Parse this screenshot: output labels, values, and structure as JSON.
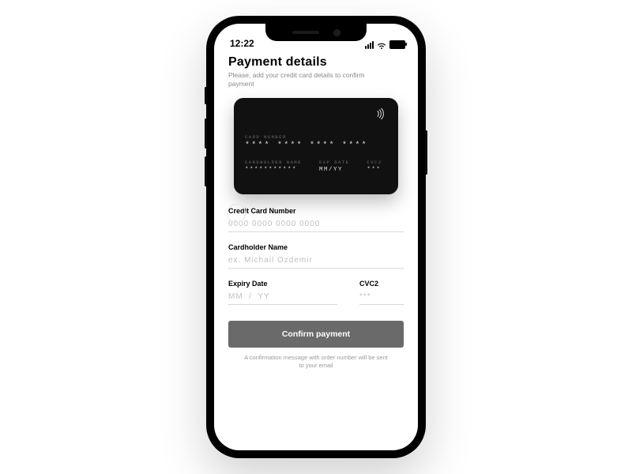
{
  "status": {
    "time": "12:22"
  },
  "header": {
    "title": "Payment details",
    "subtitle": "Please, add your credit card details to confirm payment"
  },
  "card": {
    "number_label": "CARD NUMBER",
    "number_value": "**** **** **** ****",
    "holder_label": "CARDHOLDER NAME",
    "holder_value": "***********",
    "exp_label": "EXP DATE",
    "exp_value": "MM/YY",
    "cvc_label": "CVC2",
    "cvc_value": "***"
  },
  "form": {
    "card_number": {
      "label": "Credit Card Number",
      "placeholder": "0000 0000 0000 0000"
    },
    "holder": {
      "label": "Cardholder Name",
      "placeholder": "ex. Michail Ozdemir"
    },
    "expiry": {
      "label": "Expiry Date",
      "placeholder": "MM  /  YY"
    },
    "cvc": {
      "label": "CVC2",
      "placeholder": "***"
    }
  },
  "cta": {
    "label": "Confirm payment"
  },
  "footnote": "A confirmation message with order number will be sent to your email"
}
